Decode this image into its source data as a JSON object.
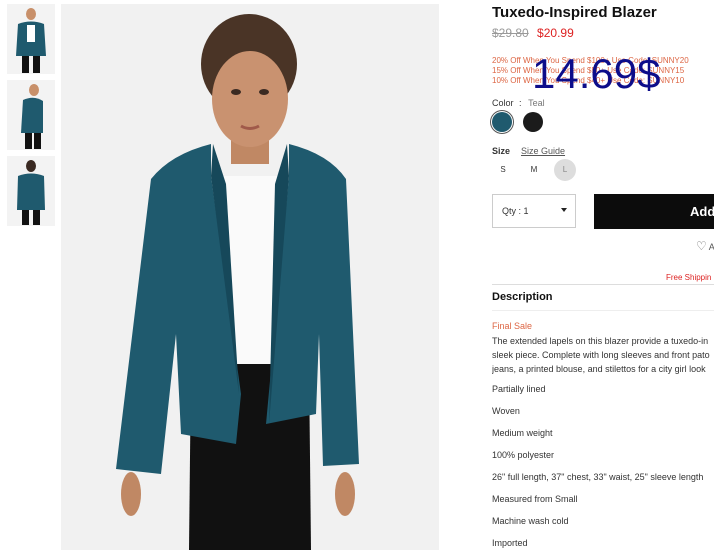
{
  "product": {
    "title": "Tuxedo-Inspired Blazer",
    "old_price": "$29.80",
    "new_price": "$20.99",
    "overlay_price": "14.69$",
    "promos": [
      "20% Off When You Spend $100+ Use Code: SUNNY20",
      "15% Off When You Spend $50+ Use Code: SUNNY15",
      "10% Off When You Spend $40+ Use Code: SUNNY10"
    ]
  },
  "color": {
    "label": "Color",
    "separator": ":",
    "value": "Teal",
    "swatches": [
      "#1f5a6e",
      "#1b1b1b"
    ]
  },
  "size": {
    "label": "Size",
    "guide": "Size Guide",
    "options": [
      "S",
      "M",
      "L"
    ]
  },
  "purchase": {
    "qty_label": "Qty : 1",
    "add_label": "Add",
    "wishlist_label": "A",
    "free_shipping": "Free Shippin"
  },
  "description": {
    "heading": "Description",
    "final_sale": "Final Sale",
    "paragraph": [
      "The extended lapels on this blazer provide a tuxedo-in",
      "sleek piece. Complete with long sleeves and front pato",
      "jeans, a printed blouse, and stilettos for a city girl look"
    ],
    "features": [
      "Partially lined",
      "Woven",
      "Medium weight",
      "100% polyester",
      "26\" full length, 37\" chest, 33\" waist, 25\" sleeve length",
      "Measured from Small",
      "Machine wash cold",
      "Imported"
    ]
  },
  "colors": {
    "accent_red": "#dd2222",
    "promo": "#dd6644",
    "overlay": "#0d0d8a",
    "button": "#0c0c0c"
  }
}
